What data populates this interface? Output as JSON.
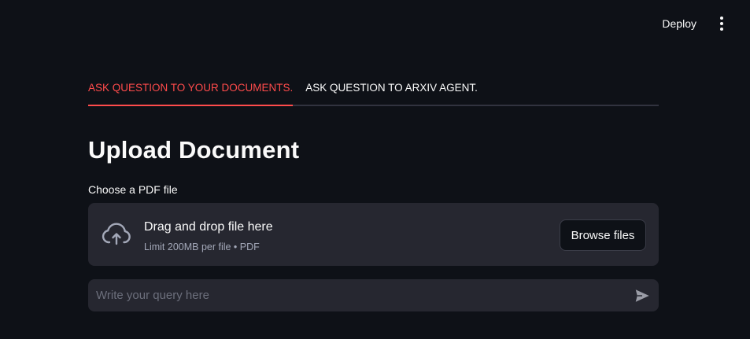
{
  "header": {
    "deploy_label": "Deploy",
    "menu_icon": "more-vertical-icon"
  },
  "tabs": [
    {
      "label": "ASK QUESTION TO YOUR DOCUMENTS.",
      "active": true
    },
    {
      "label": "ASK QUESTION TO ARXIV AGENT.",
      "active": false
    }
  ],
  "main": {
    "title": "Upload Document",
    "uploader": {
      "label": "Choose a PDF file",
      "drop_title": "Drag and drop file here",
      "drop_limit": "Limit 200MB per file • PDF",
      "browse_label": "Browse files",
      "icon": "cloud-upload-icon"
    },
    "chat": {
      "placeholder": "Write your query here",
      "value": "",
      "send_icon": "send-icon"
    }
  },
  "colors": {
    "background": "#0e1117",
    "surface": "#262730",
    "accent": "#ff4b4b",
    "text": "#fafafa",
    "muted_text": "#a3a8b8"
  }
}
